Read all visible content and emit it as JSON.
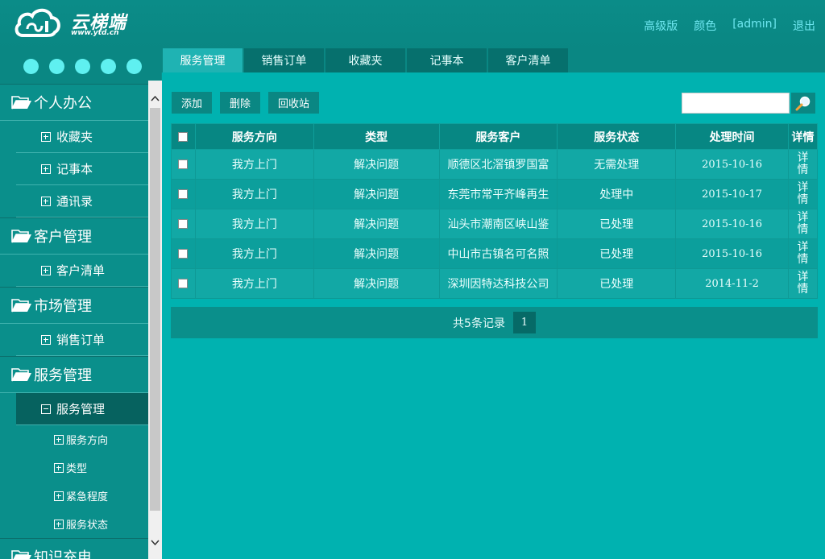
{
  "logo": {
    "text": "云梯端",
    "url": "www.ytd.cn"
  },
  "header": {
    "links": [
      "高级版",
      "颜色",
      "[admin]",
      "退出"
    ]
  },
  "tabs": [
    "服务管理",
    "销售订单",
    "收藏夹",
    "记事本",
    "客户清单"
  ],
  "sidebar": {
    "personal": {
      "label": "个人办公",
      "items": [
        "收藏夹",
        "记事本",
        "通讯录"
      ]
    },
    "customer": {
      "label": "客户管理",
      "items": [
        "客户清单"
      ]
    },
    "market": {
      "label": "市场管理",
      "items": [
        "销售订单"
      ]
    },
    "service": {
      "label": "服务管理",
      "item": "服务管理",
      "leaves": [
        "服务方向",
        "类型",
        "紧急程度",
        "服务状态"
      ]
    },
    "knowledge": {
      "label": "知识充电"
    }
  },
  "toolbar": {
    "add": "添加",
    "delete": "删除",
    "recycle": "回收站"
  },
  "search": {
    "value": "",
    "icon": "magnifier-icon"
  },
  "table": {
    "headers": [
      "服务方向",
      "类型",
      "服务客户",
      "服务状态",
      "处理时间",
      "详情"
    ],
    "rows": [
      [
        "我方上门",
        "解决问题",
        "顺德区北滘镇罗国富",
        "无需处理",
        "2015-10-16",
        "详情"
      ],
      [
        "我方上门",
        "解决问题",
        "东莞市常平齐峰再生",
        "处理中",
        "2015-10-17",
        "详情"
      ],
      [
        "我方上门",
        "解决问题",
        "汕头市潮南区峡山鉴",
        "已处理",
        "2015-10-16",
        "详情"
      ],
      [
        "我方上门",
        "解决问题",
        "中山市古镇名可名照",
        "已处理",
        "2015-10-16",
        "详情"
      ],
      [
        "我方上门",
        "解决问题",
        "深圳因特达科技公司",
        "已处理",
        "2014-11-2",
        "详情"
      ]
    ]
  },
  "pager": {
    "summary": "共5条记录",
    "page": "1"
  }
}
